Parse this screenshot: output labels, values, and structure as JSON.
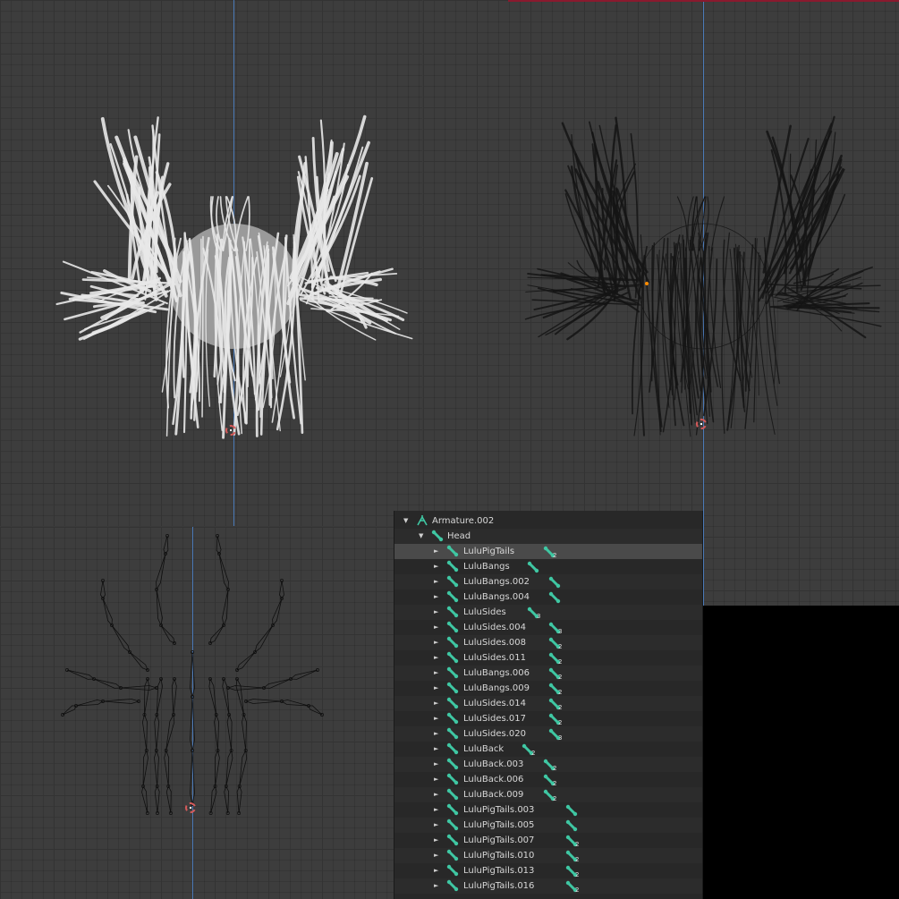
{
  "colors": {
    "grid_bg": "#3d3d3d",
    "axis": "#4b7ab8",
    "bone_icon": "#3fc7a3",
    "outliner_bg": "#282828",
    "selected_row": "#4a4a4a",
    "cursor": "#d45a5a",
    "origin_dot": "#ff8c00"
  },
  "outliner": {
    "root": {
      "label": "Armature.002",
      "icon": "armature-icon"
    },
    "parent": {
      "label": "Head",
      "icon": "bone-icon"
    },
    "children": [
      {
        "label": "LuluPigTails",
        "count": "2",
        "selected": true
      },
      {
        "label": "LuluBangs",
        "count": ""
      },
      {
        "label": "LuluBangs.002",
        "count": ""
      },
      {
        "label": "LuluBangs.004",
        "count": ""
      },
      {
        "label": "LuluSides",
        "count": "3"
      },
      {
        "label": "LuluSides.004",
        "count": "3"
      },
      {
        "label": "LuluSides.008",
        "count": "2"
      },
      {
        "label": "LuluSides.011",
        "count": "2"
      },
      {
        "label": "LuluBangs.006",
        "count": "2"
      },
      {
        "label": "LuluBangs.009",
        "count": "2"
      },
      {
        "label": "LuluSides.014",
        "count": "2"
      },
      {
        "label": "LuluSides.017",
        "count": "2"
      },
      {
        "label": "LuluSides.020",
        "count": "3"
      },
      {
        "label": "LuluBack",
        "count": "2"
      },
      {
        "label": "LuluBack.003",
        "count": "2"
      },
      {
        "label": "LuluBack.006",
        "count": "2"
      },
      {
        "label": "LuluBack.009",
        "count": "2"
      },
      {
        "label": "LuluPigTails.003",
        "count": ""
      },
      {
        "label": "LuluPigTails.005",
        "count": ""
      },
      {
        "label": "LuluPigTails.007",
        "count": "2"
      },
      {
        "label": "LuluPigTails.010",
        "count": "2"
      },
      {
        "label": "LuluPigTails.013",
        "count": "2"
      },
      {
        "label": "LuluPigTails.016",
        "count": "2"
      }
    ]
  }
}
